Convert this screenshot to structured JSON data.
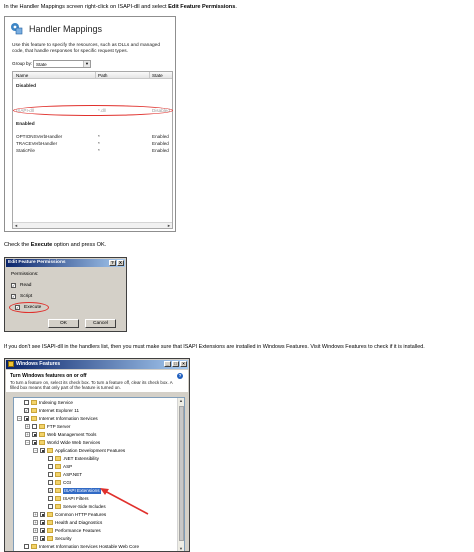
{
  "step1": {
    "text_pre": "In the Handler Mappings screen right-click on ISAPI-dll and select ",
    "text_bold": "Edit Feature Permissions",
    "text_post": "."
  },
  "handler_mappings": {
    "title": "Handler Mappings",
    "description": "Use this feature to specify the resources, such as DLLs and managed code, that handle responses for specific request types.",
    "group_by_label": "Group by:",
    "group_by_value": "State",
    "columns": [
      "Name",
      "Path",
      "State"
    ],
    "groups": [
      {
        "label": "Disabled",
        "rows": [
          {
            "name": "ISAPI-dll",
            "path": "*.dll",
            "state": "Disabled"
          }
        ]
      },
      {
        "label": "Enabled",
        "rows": [
          {
            "name": "OPTIONSVerbHandler",
            "path": "*",
            "state": "Enabled"
          },
          {
            "name": "TRACEVerbHandler",
            "path": "*",
            "state": "Enabled"
          },
          {
            "name": "StaticFile",
            "path": "*",
            "state": "Enabled"
          }
        ]
      }
    ],
    "highlight_color": "#e0302c"
  },
  "step2": {
    "text_pre": "Check the ",
    "text_bold": "Execute",
    "text_post": " option and press OK."
  },
  "edit_feature_permissions": {
    "title": "Edit Feature Permissions",
    "help_button": "?",
    "close_button": "X",
    "permissions_label": "Permissions:",
    "options": [
      {
        "label": "Read",
        "checked": true
      },
      {
        "label": "Script",
        "checked": true
      },
      {
        "label": "Execute",
        "checked": true
      }
    ],
    "ok_label": "OK",
    "cancel_label": "Cancel"
  },
  "step3": {
    "text": "If you don't see ISAPI-dll in the handlers list, then you must make sure that ISAPI Extensions are installed in Windows Features. Visit Windows Features to check if it is installed."
  },
  "windows_features": {
    "title": "Windows Features",
    "heading": "Turn Windows features on or off",
    "description": "To turn a feature on, select its check box. To turn a feature off, clear its check box. A filled box means that only part of the feature is turned on.",
    "help_icon": "?",
    "tree": [
      {
        "label": "Indexing Service",
        "level": 0,
        "state": "unchecked",
        "expander": ""
      },
      {
        "label": "Internet Explorer 11",
        "level": 0,
        "state": "checked",
        "expander": ""
      },
      {
        "label": "Internet Information Services",
        "level": 0,
        "state": "partial",
        "expander": "−"
      },
      {
        "label": "FTP Server",
        "level": 1,
        "state": "unchecked",
        "expander": "+"
      },
      {
        "label": "Web Management Tools",
        "level": 1,
        "state": "partial",
        "expander": "+"
      },
      {
        "label": "World Wide Web Services",
        "level": 1,
        "state": "partial",
        "expander": "−"
      },
      {
        "label": "Application Development Features",
        "level": 2,
        "state": "partial",
        "expander": "−"
      },
      {
        "label": ".NET Extensibility",
        "level": 3,
        "state": "unchecked",
        "expander": ""
      },
      {
        "label": "ASP",
        "level": 3,
        "state": "unchecked",
        "expander": ""
      },
      {
        "label": "ASP.NET",
        "level": 3,
        "state": "unchecked",
        "expander": ""
      },
      {
        "label": "CGI",
        "level": 3,
        "state": "unchecked",
        "expander": ""
      },
      {
        "label": "ISAPI Extensions",
        "level": 3,
        "state": "checked",
        "expander": "",
        "selected": true
      },
      {
        "label": "ISAPI Filters",
        "level": 3,
        "state": "unchecked",
        "expander": ""
      },
      {
        "label": "Server-Side Includes",
        "level": 3,
        "state": "unchecked",
        "expander": ""
      },
      {
        "label": "Common HTTP Features",
        "level": 2,
        "state": "partial",
        "expander": "+"
      },
      {
        "label": "Health and Diagnostics",
        "level": 2,
        "state": "partial",
        "expander": "+"
      },
      {
        "label": "Performance Features",
        "level": 2,
        "state": "partial",
        "expander": "+"
      },
      {
        "label": "Security",
        "level": 2,
        "state": "partial",
        "expander": "+"
      },
      {
        "label": "Internet Information Services Hostable Web Core",
        "level": 0,
        "state": "unchecked",
        "expander": ""
      }
    ],
    "titlebar_color": "#0a246a",
    "arrow_color": "#e0302c"
  }
}
